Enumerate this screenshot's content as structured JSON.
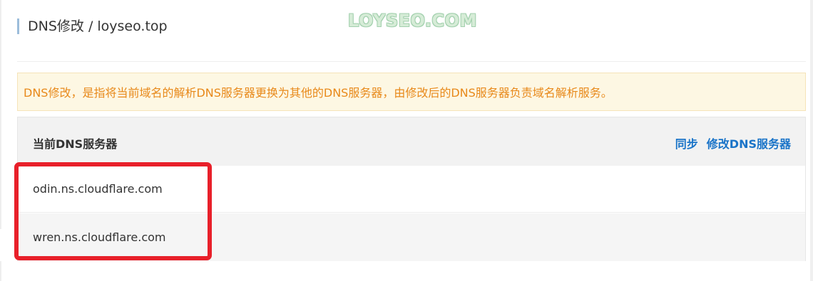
{
  "header": {
    "title": "DNS修改 / loyseo.top"
  },
  "watermark": "LOYSEO.COM",
  "notice": {
    "text": "DNS修改，是指将当前域名的解析DNS服务器更换为其他的DNS服务器，由修改后的DNS服务器负责域名解析服务。"
  },
  "panel": {
    "title": "当前DNS服务器",
    "actions": [
      {
        "label": "同步"
      },
      {
        "label": "修改DNS服务器"
      }
    ],
    "nameservers": [
      "odin.ns.cloudflare.com",
      "wren.ns.cloudflare.com"
    ]
  },
  "colors": {
    "accent_link": "#1a74c8",
    "notice_text": "#e8891a",
    "notice_bg": "#fdf7e3",
    "highlight_border": "#e8202a",
    "title_bar": "#9cbddb"
  }
}
